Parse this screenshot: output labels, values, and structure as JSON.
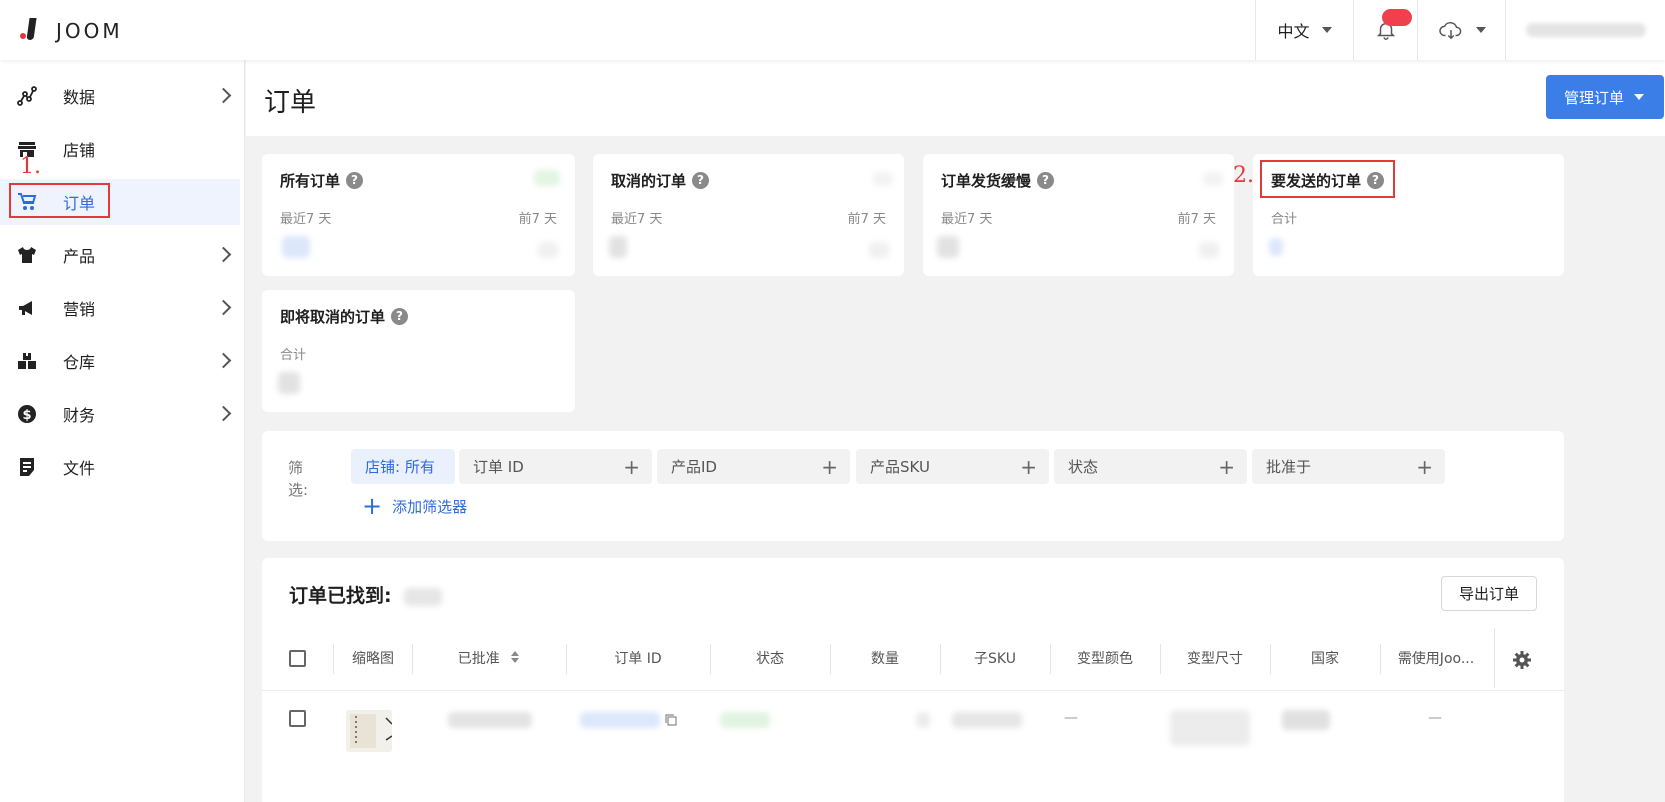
{
  "topbar": {
    "logo_text": "JOOM",
    "language": "中文"
  },
  "sidebar": {
    "items": [
      {
        "label": "数据",
        "icon": "chart-line-icon"
      },
      {
        "label": "店铺",
        "icon": "store-icon"
      },
      {
        "label": "订单",
        "icon": "cart-icon"
      },
      {
        "label": "产品",
        "icon": "tshirt-icon"
      },
      {
        "label": "营销",
        "icon": "megaphone-icon"
      },
      {
        "label": "仓库",
        "icon": "boxes-icon"
      },
      {
        "label": "财务",
        "icon": "dollar-circle-icon"
      },
      {
        "label": "文件",
        "icon": "document-icon"
      }
    ],
    "active": "订单"
  },
  "annotations": {
    "one": "1.",
    "two": "2."
  },
  "header": {
    "title": "订单",
    "manage_button": "管理订单"
  },
  "cards": [
    {
      "title": "所有订单",
      "left_label": "最近7 天",
      "right_label": "前7 天"
    },
    {
      "title": "取消的订单",
      "left_label": "最近7 天",
      "right_label": "前7 天"
    },
    {
      "title": "订单发货缓慢",
      "left_label": "最近7 天",
      "right_label": "前7 天"
    },
    {
      "title": "要发送的订单",
      "left_label": "合计"
    },
    {
      "title": "即将取消的订单",
      "left_label": "合计"
    }
  ],
  "help_glyph": "?",
  "filter": {
    "label": "筛选:",
    "chips": [
      {
        "label": "店铺: 所有",
        "active": true
      },
      {
        "label": "订单 ID"
      },
      {
        "label": "产品ID"
      },
      {
        "label": "产品SKU"
      },
      {
        "label": "状态"
      },
      {
        "label": "批准于"
      }
    ],
    "plus_glyph": "+",
    "add_filter": "添加筛选器"
  },
  "results": {
    "title": "订单已找到:",
    "export_button": "导出订单",
    "columns": [
      "缩略图",
      "已批准",
      "订单 ID",
      "状态",
      "数量",
      "子SKU",
      "变型颜色",
      "变型尺寸",
      "国家",
      "需使用Joo..."
    ],
    "dash": "—"
  },
  "colors": {
    "accent": "#3b7ee8",
    "annotation": "#e23a3a",
    "badge": "#f0404e"
  }
}
